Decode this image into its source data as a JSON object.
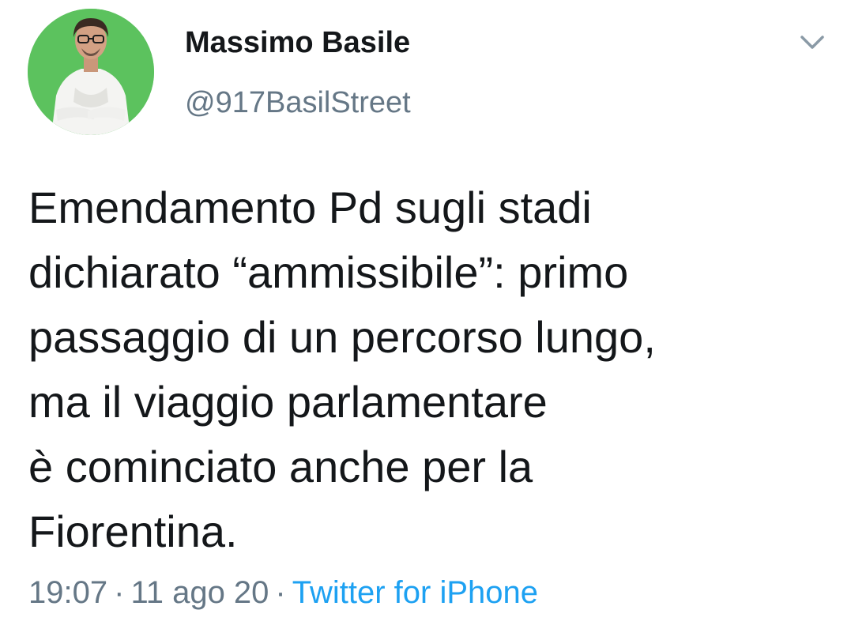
{
  "author": {
    "name": "Massimo Basile",
    "handle": "@917BasilStreet"
  },
  "tweet": {
    "text": "Emendamento Pd sugli stadi\ndichiarato “ammissibile”: primo\npassaggio di un percorso lungo,\nma il viaggio parlamentare\nè cominciato anche per la\nFiorentina.",
    "time": "19:07",
    "date": "11 ago 20",
    "source": "Twitter for iPhone",
    "separator": "·"
  },
  "colors": {
    "avatar_bg": "#5cc25e",
    "text": "#14171a",
    "muted": "#657786",
    "link": "#1da1f2"
  },
  "icons": {
    "menu": "chevron-down-icon"
  }
}
